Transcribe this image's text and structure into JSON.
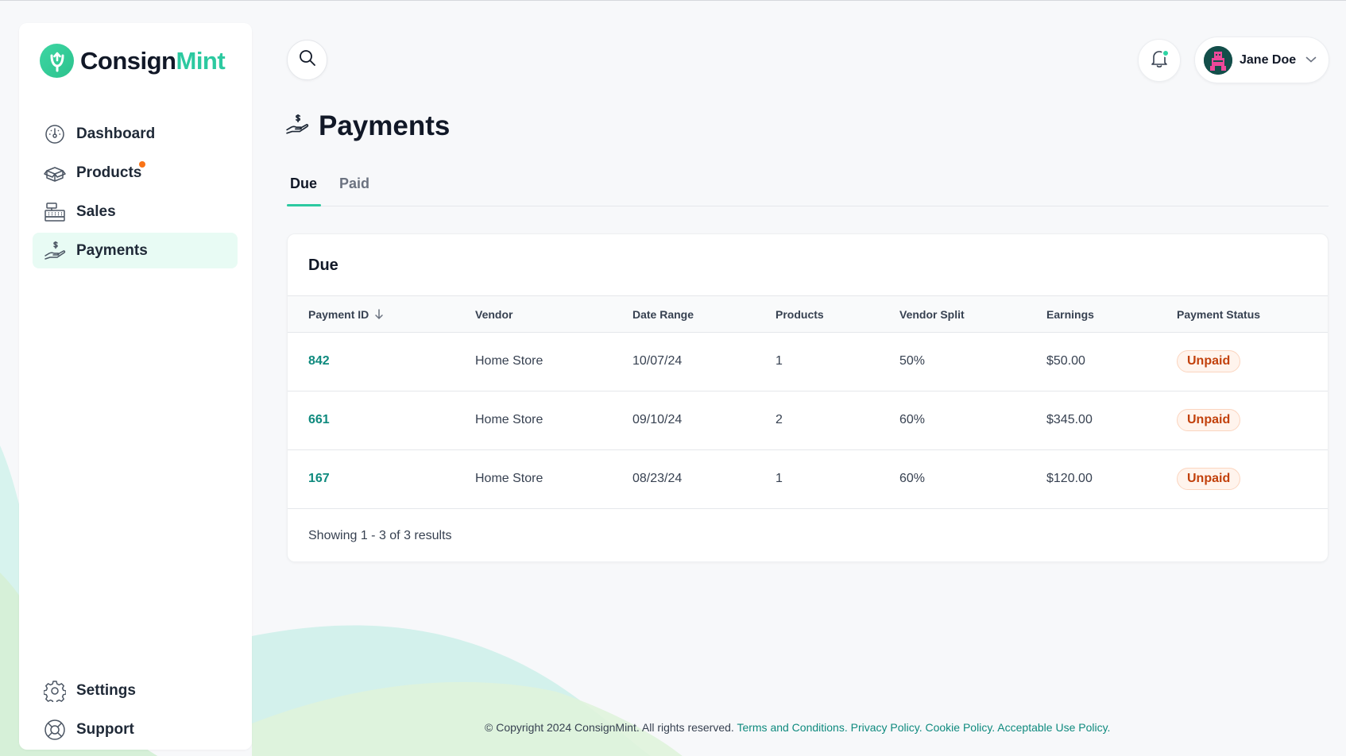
{
  "brand": {
    "part1": "Consign",
    "part2": "Mint",
    "accent": "#2cc9a0"
  },
  "sidebar": {
    "items": [
      {
        "label": "Dashboard",
        "icon": "dashboard-icon"
      },
      {
        "label": "Products",
        "icon": "box-icon",
        "has_dot": true
      },
      {
        "label": "Sales",
        "icon": "cash-register-icon"
      },
      {
        "label": "Payments",
        "icon": "hand-dollar-icon",
        "active": true
      }
    ],
    "bottom_items": [
      {
        "label": "Settings",
        "icon": "gear-icon"
      },
      {
        "label": "Support",
        "icon": "lifebuoy-icon"
      }
    ]
  },
  "header": {
    "user_name": "Jane Doe"
  },
  "page": {
    "title": "Payments",
    "tabs": [
      {
        "label": "Due",
        "active": true
      },
      {
        "label": "Paid",
        "active": false
      }
    ]
  },
  "card": {
    "title": "Due",
    "columns": [
      "Payment ID",
      "Vendor",
      "Date Range",
      "Products",
      "Vendor Split",
      "Earnings",
      "Payment Status"
    ],
    "rows": [
      {
        "id": "842",
        "vendor": "Home Store",
        "date": "10/07/24",
        "products": "1",
        "split": "50%",
        "earnings": "$50.00",
        "status": "Unpaid"
      },
      {
        "id": "661",
        "vendor": "Home Store",
        "date": "09/10/24",
        "products": "2",
        "split": "60%",
        "earnings": "$345.00",
        "status": "Unpaid"
      },
      {
        "id": "167",
        "vendor": "Home Store",
        "date": "08/23/24",
        "products": "1",
        "split": "60%",
        "earnings": "$120.00",
        "status": "Unpaid"
      }
    ],
    "summary": "Showing 1 - 3 of 3 results"
  },
  "footer": {
    "copyright": "© Copyright 2024 ConsignMint. All rights reserved.",
    "links": [
      "Terms and Conditions.",
      "Privacy Policy.",
      "Cookie Policy.",
      "Acceptable Use Policy."
    ]
  }
}
